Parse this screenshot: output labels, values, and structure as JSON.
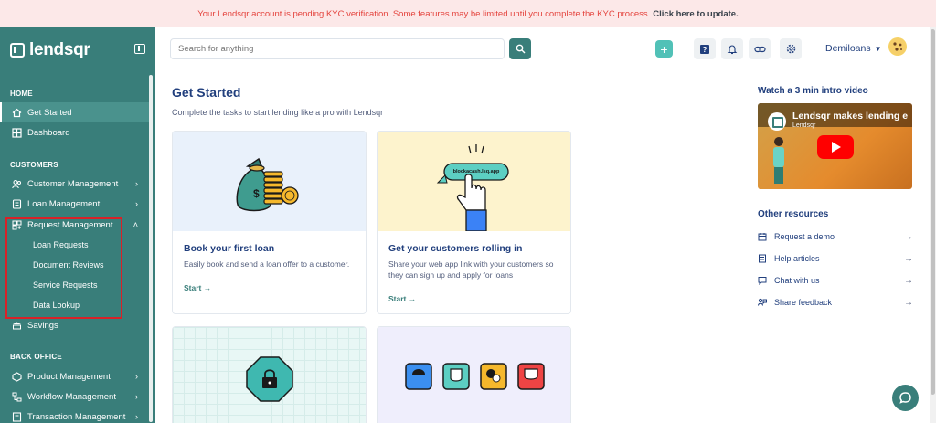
{
  "banner": {
    "message": "Your Lendsqr account is pending KYC verification. Some features may be limited until you complete the KYC process.",
    "link": "Click here to update."
  },
  "sidebar": {
    "logo_text": "lendsqr",
    "sections": {
      "home": "HOME",
      "customers": "CUSTOMERS",
      "back_office": "BACK OFFICE"
    },
    "items": {
      "get_started": "Get Started",
      "dashboard": "Dashboard",
      "customer_management": "Customer Management",
      "loan_management": "Loan Management",
      "request_management": "Request Management",
      "savings": "Savings",
      "product_management": "Product Management",
      "workflow_management": "Workflow Management",
      "transaction_management": "Transaction Management"
    },
    "sub_items": {
      "loan_requests": "Loan Requests",
      "document_reviews": "Document Reviews",
      "service_requests": "Service Requests",
      "data_lookup": "Data Lookup"
    }
  },
  "header": {
    "search_placeholder": "Search for anything",
    "user_name": "Demiloans"
  },
  "main": {
    "title": "Get Started",
    "subtitle": "Complete the tasks to start lending like a pro with Lendsqr",
    "cards": [
      {
        "title": "Book your first loan",
        "desc": "Easily book and send a loan offer to a customer.",
        "link": "Start →"
      },
      {
        "title": "Get your customers rolling in",
        "desc": "Share your web app link with your customers so they can sign up and apply for loans",
        "link": "Start →",
        "url_chip": "blockacash.lsq.app"
      }
    ]
  },
  "right": {
    "video_title": "Watch a 3 min intro video",
    "video_headline": "Lendsqr makes lending e",
    "video_channel": "Lendsqr",
    "resources_title": "Other resources",
    "resources": [
      "Request a demo",
      "Help articles",
      "Chat with us",
      "Share feedback"
    ]
  },
  "colors": {
    "sidebar": "#397e7a",
    "accent": "#51c1b7",
    "banner_bg": "#fce8e8",
    "banner_text": "#e4433d",
    "highlight": "#d92128",
    "primary_text": "#213f7d"
  }
}
